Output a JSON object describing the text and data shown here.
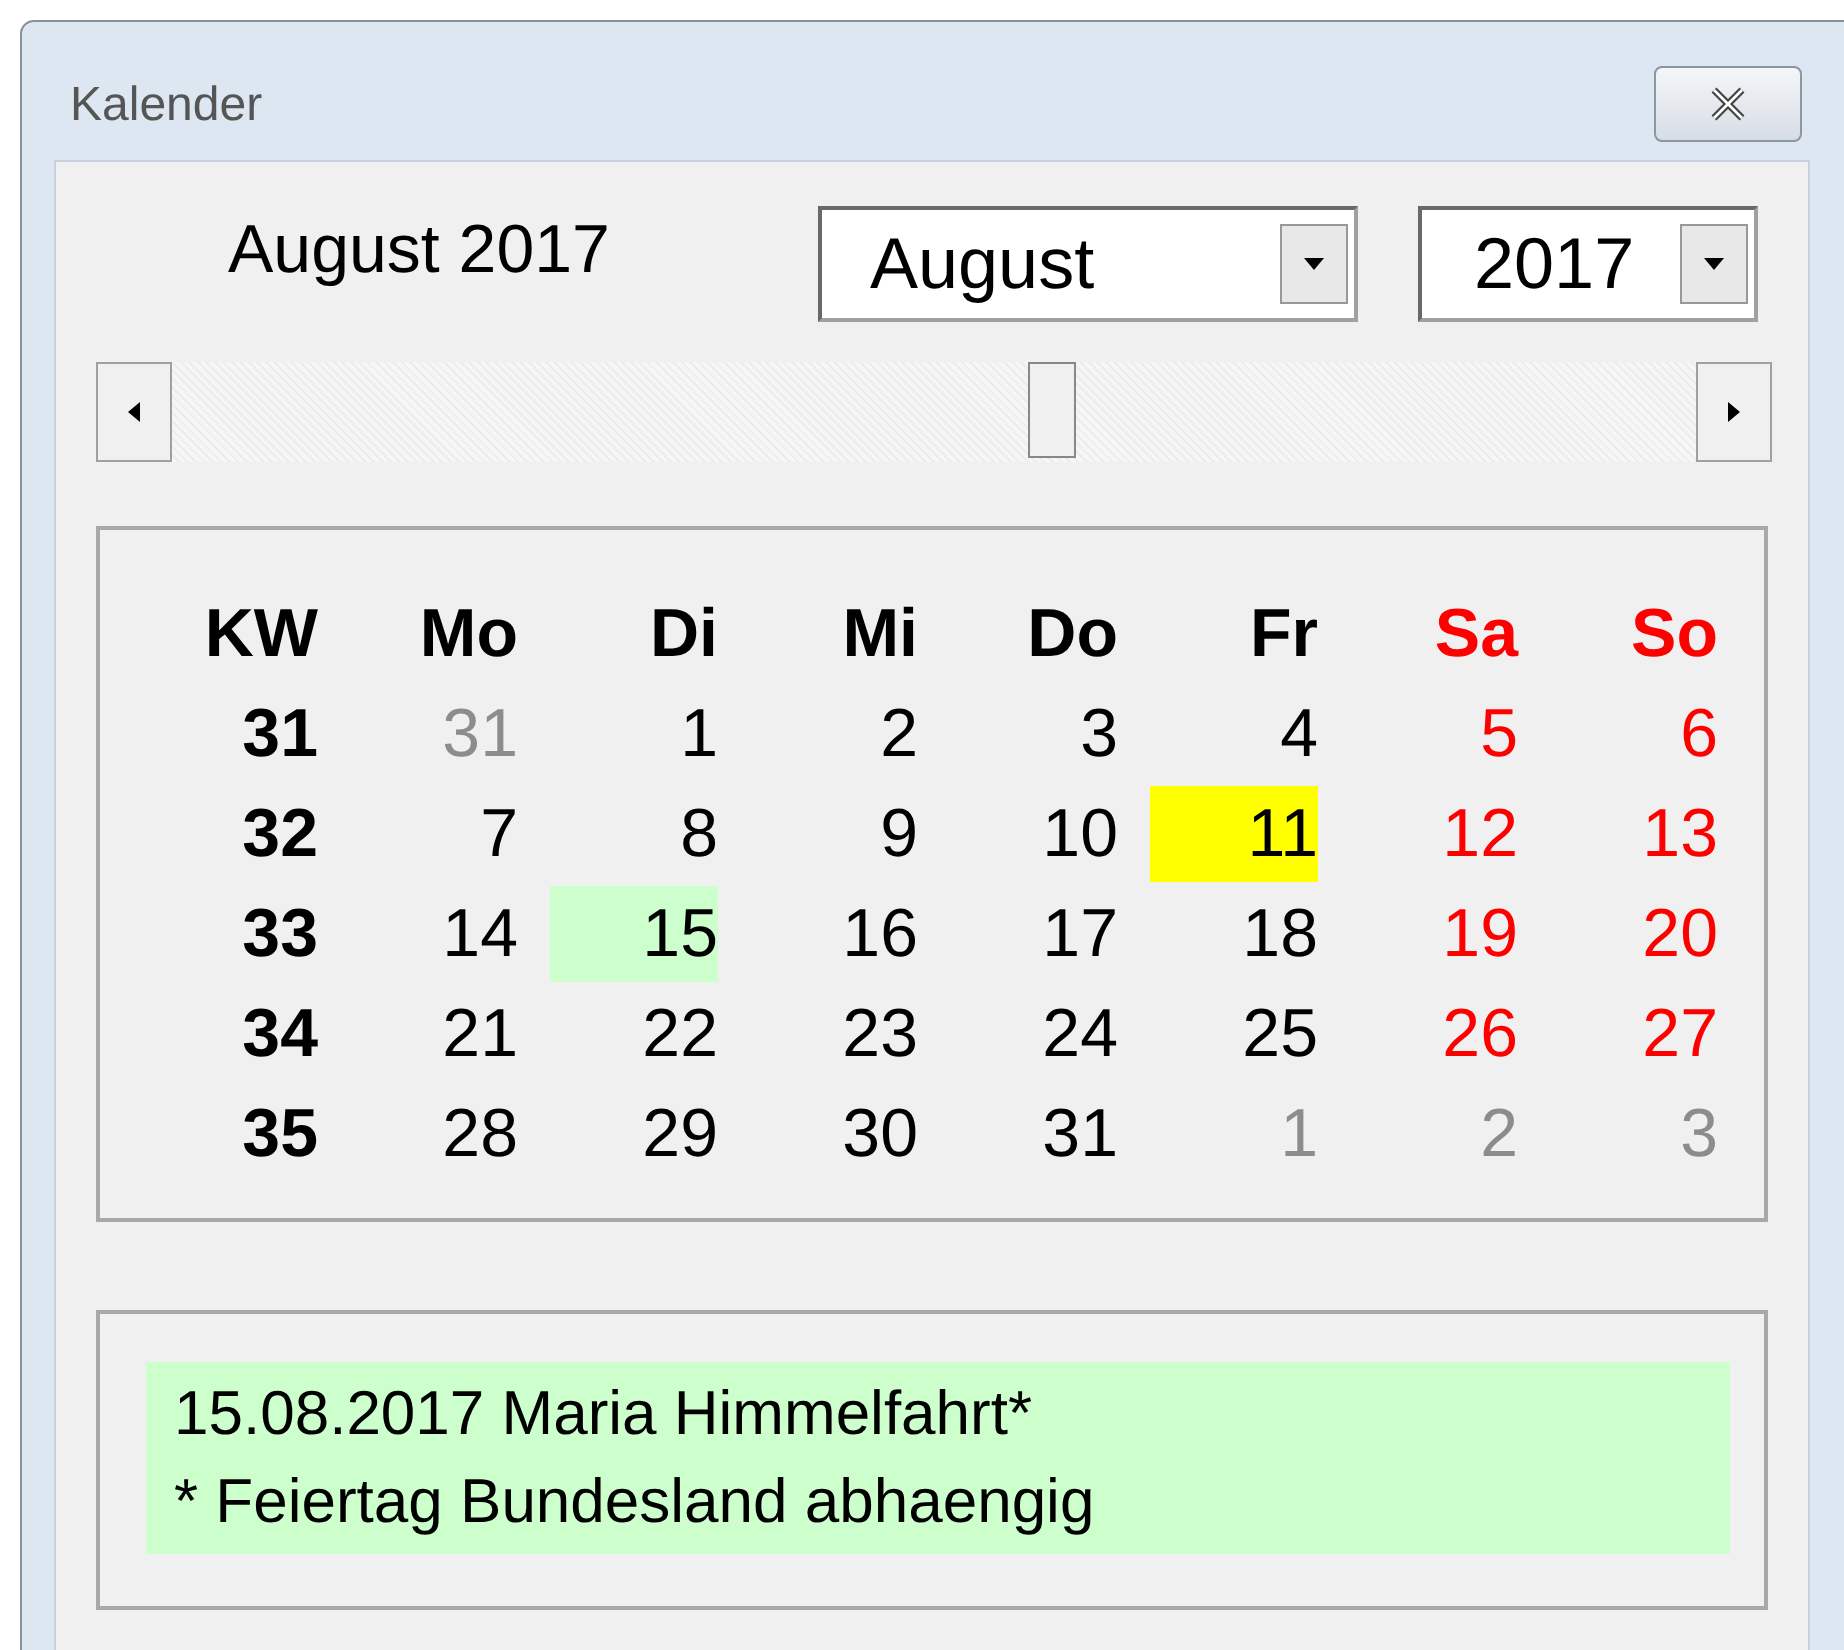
{
  "window": {
    "title": "Kalender"
  },
  "heading": "August 2017",
  "month_select": {
    "value": "August"
  },
  "year_select": {
    "value": "2017"
  },
  "scrollbar": {
    "level": 0.58
  },
  "calendar": {
    "headers": [
      {
        "label": "KW",
        "weekend": false
      },
      {
        "label": "Mo",
        "weekend": false
      },
      {
        "label": "Di",
        "weekend": false
      },
      {
        "label": "Mi",
        "weekend": false
      },
      {
        "label": "Do",
        "weekend": false
      },
      {
        "label": "Fr",
        "weekend": false
      },
      {
        "label": "Sa",
        "weekend": true
      },
      {
        "label": "So",
        "weekend": true
      }
    ],
    "weeks": [
      {
        "week": "31",
        "days": [
          {
            "day": "31",
            "muted": true,
            "today": false,
            "holiday": false
          },
          {
            "day": "1",
            "muted": false,
            "today": false,
            "holiday": false
          },
          {
            "day": "2",
            "muted": false,
            "today": false,
            "holiday": false
          },
          {
            "day": "3",
            "muted": false,
            "today": false,
            "holiday": false
          },
          {
            "day": "4",
            "muted": false,
            "today": false,
            "holiday": false
          },
          {
            "day": "5",
            "muted": false,
            "today": false,
            "holiday": false
          },
          {
            "day": "6",
            "muted": false,
            "today": false,
            "holiday": false
          }
        ]
      },
      {
        "week": "32",
        "days": [
          {
            "day": "7",
            "muted": false,
            "today": false,
            "holiday": false
          },
          {
            "day": "8",
            "muted": false,
            "today": false,
            "holiday": false
          },
          {
            "day": "9",
            "muted": false,
            "today": false,
            "holiday": false
          },
          {
            "day": "10",
            "muted": false,
            "today": false,
            "holiday": false
          },
          {
            "day": "11",
            "muted": false,
            "today": true,
            "holiday": false
          },
          {
            "day": "12",
            "muted": false,
            "today": false,
            "holiday": false
          },
          {
            "day": "13",
            "muted": false,
            "today": false,
            "holiday": false
          }
        ]
      },
      {
        "week": "33",
        "days": [
          {
            "day": "14",
            "muted": false,
            "today": false,
            "holiday": false
          },
          {
            "day": "15",
            "muted": false,
            "today": false,
            "holiday": true
          },
          {
            "day": "16",
            "muted": false,
            "today": false,
            "holiday": false
          },
          {
            "day": "17",
            "muted": false,
            "today": false,
            "holiday": false
          },
          {
            "day": "18",
            "muted": false,
            "today": false,
            "holiday": false
          },
          {
            "day": "19",
            "muted": false,
            "today": false,
            "holiday": false
          },
          {
            "day": "20",
            "muted": false,
            "today": false,
            "holiday": false
          }
        ]
      },
      {
        "week": "34",
        "days": [
          {
            "day": "21",
            "muted": false,
            "today": false,
            "holiday": false
          },
          {
            "day": "22",
            "muted": false,
            "today": false,
            "holiday": false
          },
          {
            "day": "23",
            "muted": false,
            "today": false,
            "holiday": false
          },
          {
            "day": "24",
            "muted": false,
            "today": false,
            "holiday": false
          },
          {
            "day": "25",
            "muted": false,
            "today": false,
            "holiday": false
          },
          {
            "day": "26",
            "muted": false,
            "today": false,
            "holiday": false
          },
          {
            "day": "27",
            "muted": false,
            "today": false,
            "holiday": false
          }
        ]
      },
      {
        "week": "35",
        "days": [
          {
            "day": "28",
            "muted": false,
            "today": false,
            "holiday": false
          },
          {
            "day": "29",
            "muted": false,
            "today": false,
            "holiday": false
          },
          {
            "day": "30",
            "muted": false,
            "today": false,
            "holiday": false
          },
          {
            "day": "31",
            "muted": false,
            "today": false,
            "holiday": false
          },
          {
            "day": "1",
            "muted": true,
            "today": false,
            "holiday": false
          },
          {
            "day": "2",
            "muted": true,
            "today": false,
            "holiday": false
          },
          {
            "day": "3",
            "muted": true,
            "today": false,
            "holiday": false
          }
        ]
      }
    ]
  },
  "info": {
    "lines": [
      "15.08.2017 Maria Himmelfahrt*",
      "* Feiertag Bundesland abhaengig"
    ]
  }
}
